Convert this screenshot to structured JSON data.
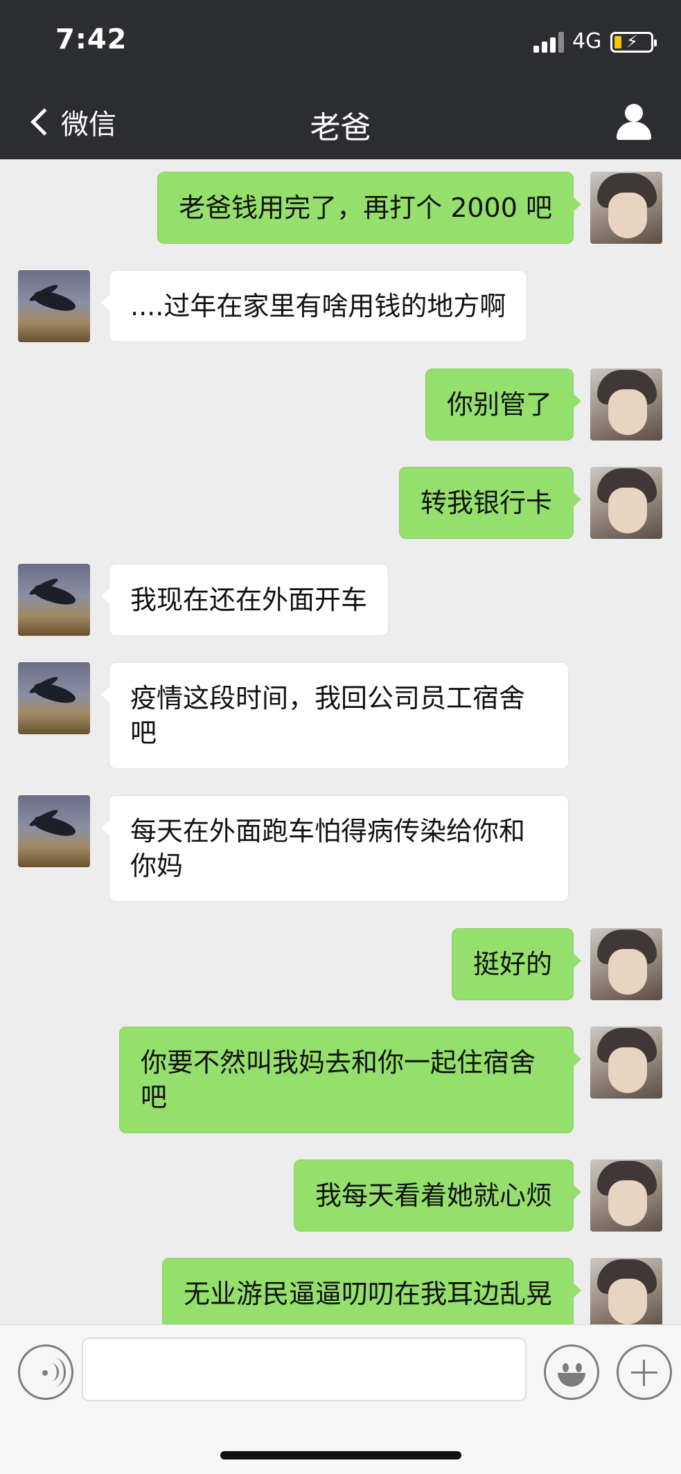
{
  "status_bar": {
    "time": "7:42",
    "network": "4G"
  },
  "nav": {
    "back_label": "微信",
    "title": "老爸"
  },
  "messages": [
    {
      "sender": "me",
      "text": "老爸钱用完了，再打个 2000 吧"
    },
    {
      "sender": "dad",
      "text": "....过年在家里有啥用钱的地方啊"
    },
    {
      "sender": "me",
      "text": "你别管了"
    },
    {
      "sender": "me",
      "text": "转我银行卡"
    },
    {
      "sender": "dad",
      "text": "我现在还在外面开车"
    },
    {
      "sender": "dad",
      "text": "疫情这段时间，我回公司员工宿舍吧"
    },
    {
      "sender": "dad",
      "text": "每天在外面跑车怕得病传染给你和你妈"
    },
    {
      "sender": "me",
      "text": "挺好的"
    },
    {
      "sender": "me",
      "text": "你要不然叫我妈去和你一起住宿舍吧"
    },
    {
      "sender": "me",
      "text": "我每天看着她就心烦"
    },
    {
      "sender": "me",
      "text": "无业游民逼逼叨叨在我耳边乱晃"
    }
  ],
  "input": {
    "value": "",
    "placeholder": ""
  },
  "colors": {
    "nav_bg": "#2c2d31",
    "chat_bg": "#ededed",
    "my_bubble": "#95e06c",
    "their_bubble": "#ffffff"
  }
}
